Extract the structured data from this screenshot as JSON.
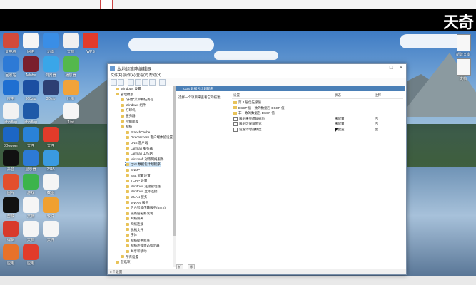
{
  "watermark": "天奇",
  "window": {
    "title": "本地组策略编辑器",
    "menu": [
      "文件(F)",
      "操作(A)",
      "查看(V)",
      "帮助(H)"
    ],
    "tree": [
      {
        "label": "Windows 设置",
        "indent": 1
      },
      {
        "label": "管理模板",
        "indent": 1
      },
      {
        "label": "\"开始\"菜单和任务栏",
        "indent": 2
      },
      {
        "label": "Windows 组件",
        "indent": 2
      },
      {
        "label": "打印机",
        "indent": 2
      },
      {
        "label": "服务器",
        "indent": 2
      },
      {
        "label": "控制面板",
        "indent": 2
      },
      {
        "label": "网络",
        "indent": 2
      },
      {
        "label": "BranchCache",
        "indent": 3
      },
      {
        "label": "DirectAccess 客户端体验设置",
        "indent": 3
      },
      {
        "label": "DNS 客户端",
        "indent": 3
      },
      {
        "label": "Lanman 服务器",
        "indent": 3
      },
      {
        "label": "Lanman 工作站",
        "indent": 3
      },
      {
        "label": "Microsoft 对等网络服务",
        "indent": 3
      },
      {
        "label": "QoS 数据包计划程序",
        "indent": 3,
        "selected": true
      },
      {
        "label": "SNMP",
        "indent": 3
      },
      {
        "label": "SSL 配置设置",
        "indent": 3
      },
      {
        "label": "TCPIP 设置",
        "indent": 3
      },
      {
        "label": "Windows 连接管理器",
        "indent": 3
      },
      {
        "label": "Windows 立即连接",
        "indent": 3
      },
      {
        "label": "WLAN 服务",
        "indent": 3
      },
      {
        "label": "WWAN 服务",
        "indent": 3
      },
      {
        "label": "后台智能传输服务(BITS)",
        "indent": 3
      },
      {
        "label": "链路层拓扑发现",
        "indent": 3
      },
      {
        "label": "网络隔离",
        "indent": 3
      },
      {
        "label": "网络连接",
        "indent": 3
      },
      {
        "label": "脱机文件",
        "indent": 3
      },
      {
        "label": "字体",
        "indent": 3
      },
      {
        "label": "网络提供程序",
        "indent": 3
      },
      {
        "label": "网络连接状态指示器",
        "indent": 3
      },
      {
        "label": "共享和移动",
        "indent": 3
      },
      {
        "label": "所有设置",
        "indent": 2
      },
      {
        "label": "首选项",
        "indent": 1
      }
    ],
    "content_header": "QoS 数据包计划程序",
    "description": "选择一个项目来查看它的描述。",
    "columns": {
      "setting": "设置",
      "state": "状态",
      "comment": "注释"
    },
    "rows": [
      {
        "type": "folder",
        "name": "第 2 层优先级值",
        "state": "",
        "comment": ""
      },
      {
        "type": "folder",
        "name": "DSCP 值一致的数据包 DSCP 值",
        "state": "",
        "comment": ""
      },
      {
        "type": "folder",
        "name": "非一致的数据包 DSCP 值",
        "state": "",
        "comment": ""
      },
      {
        "type": "policy",
        "name": "限制未完成数据包",
        "state": "未配置",
        "comment": "否"
      },
      {
        "type": "policy",
        "name": "限制可保留带宽",
        "state": "未配置",
        "comment": "否"
      },
      {
        "type": "policy",
        "name": "设置计时器精度",
        "state": "未配置",
        "comment": "否"
      }
    ],
    "tabs": [
      "扩展",
      "标准"
    ],
    "status": "5 个设置"
  },
  "desktop_icons": [
    {
      "label": "此电脑",
      "col": 0,
      "row": 0,
      "color": "#d24a3b"
    },
    {
      "label": "网络",
      "col": 1,
      "row": 0,
      "color": "#f5f5f5"
    },
    {
      "label": "迅雷",
      "col": 2,
      "row": 0,
      "color": "#3a8ee6"
    },
    {
      "label": "文档",
      "col": 3,
      "row": 0,
      "color": "#f0f0f0"
    },
    {
      "label": "WPS",
      "col": 4,
      "row": 0,
      "color": "#e23b2a"
    },
    {
      "label": "回收站",
      "col": 0,
      "row": 1,
      "color": "#2d7ad6"
    },
    {
      "label": "Adobe",
      "col": 1,
      "row": 1,
      "color": "#7a1f2d"
    },
    {
      "label": "浏览器",
      "col": 2,
      "row": 1,
      "color": "#3aa6e8"
    },
    {
      "label": "播放器",
      "col": 3,
      "row": 1,
      "color": "#54b84c"
    },
    {
      "label": "应用",
      "col": 0,
      "row": 2,
      "color": "#1f6fd1"
    },
    {
      "label": "360zip",
      "col": 1,
      "row": 2,
      "color": "#1c4fa2"
    },
    {
      "label": "3Dzip",
      "col": 2,
      "row": 2,
      "color": "#2d3f73"
    },
    {
      "label": "压缩",
      "col": 3,
      "row": 2,
      "color": "#f2a33a"
    },
    {
      "label": "abcdlog",
      "col": 0,
      "row": 3,
      "color": "#f2f2f2"
    },
    {
      "label": "abcdlog",
      "col": 1,
      "row": 3,
      "color": "#1f5aa8"
    },
    {
      "label": "1.txt",
      "col": 3,
      "row": 3,
      "color": "#f5f5f5"
    },
    {
      "label": "3Downer",
      "col": 0,
      "row": 4,
      "color": "#1c66c5"
    },
    {
      "label": "文件",
      "col": 1,
      "row": 4,
      "color": "#2a82d8"
    },
    {
      "label": "文件",
      "col": 2,
      "row": 4,
      "color": "#e23b2a"
    },
    {
      "label": "抖音",
      "col": 0,
      "row": 5,
      "color": "#111111"
    },
    {
      "label": "显示器",
      "col": 1,
      "row": 5,
      "color": "#2d7ad6"
    },
    {
      "label": "2345",
      "col": 2,
      "row": 5,
      "color": "#3a9ae0"
    },
    {
      "label": "图片",
      "col": 0,
      "row": 6,
      "color": "#e24f2d"
    },
    {
      "label": "游戏",
      "col": 1,
      "row": 6,
      "color": "#3cb44b"
    },
    {
      "label": "截图",
      "col": 2,
      "row": 6,
      "color": "#f5f5f5"
    },
    {
      "label": "剪映",
      "col": 0,
      "row": 7,
      "color": "#111111"
    },
    {
      "label": "文档",
      "col": 1,
      "row": 7,
      "color": "#f5f5f5"
    },
    {
      "label": "软件",
      "col": 2,
      "row": 7,
      "color": "#f0a030"
    },
    {
      "label": "编辑",
      "col": 0,
      "row": 8,
      "color": "#d83a2c"
    },
    {
      "label": "文档",
      "col": 1,
      "row": 8,
      "color": "#f5f5f5"
    },
    {
      "label": "文件",
      "col": 2,
      "row": 8,
      "color": "#f5f5f5"
    },
    {
      "label": "应用",
      "col": 0,
      "row": 9,
      "color": "#e8722a"
    },
    {
      "label": "应用",
      "col": 1,
      "row": 9,
      "color": "#e23b2a"
    }
  ],
  "right_icons": [
    {
      "label": "新建文本",
      "row": 0
    },
    {
      "label": "文档",
      "row": 1
    }
  ]
}
